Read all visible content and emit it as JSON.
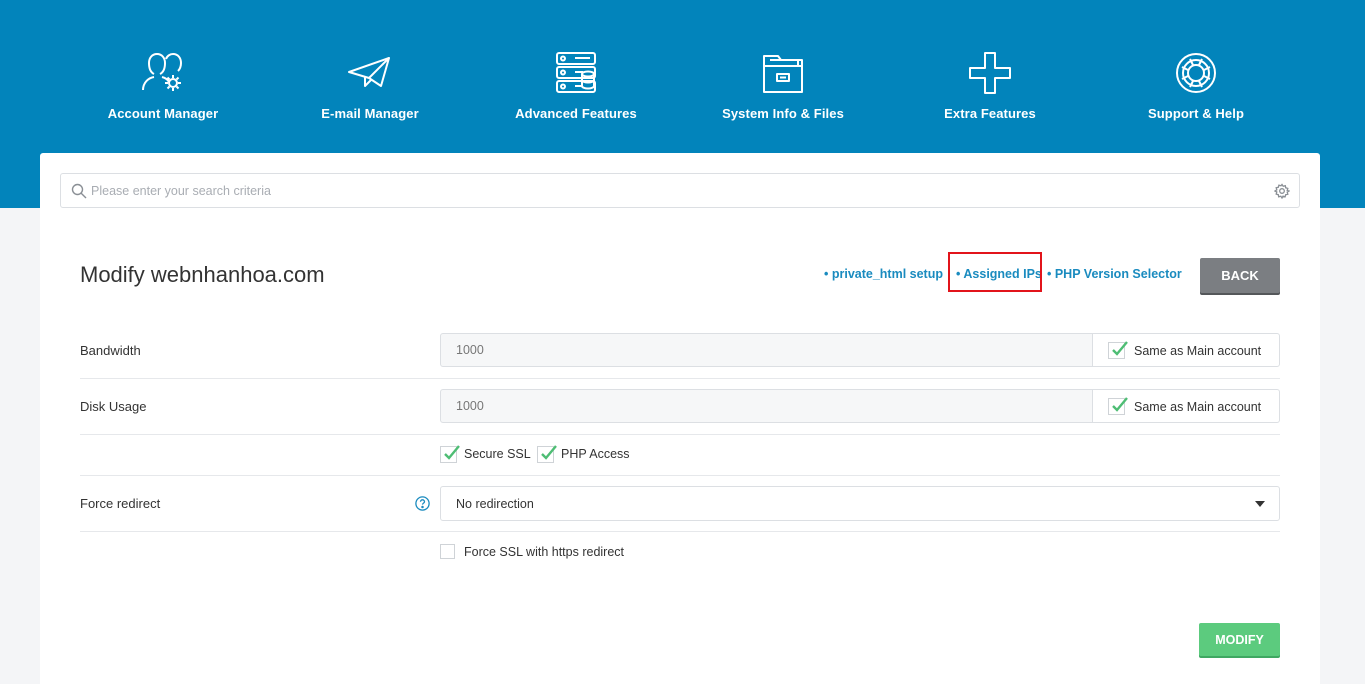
{
  "nav": {
    "items": [
      {
        "label": "Account Manager",
        "icon": "users-gear-icon"
      },
      {
        "label": "E-mail Manager",
        "icon": "paper-plane-icon"
      },
      {
        "label": "Advanced Features",
        "icon": "server-icon"
      },
      {
        "label": "System Info & Files",
        "icon": "folder-icon"
      },
      {
        "label": "Extra Features",
        "icon": "plus-icon"
      },
      {
        "label": "Support & Help",
        "icon": "lifebuoy-icon"
      }
    ]
  },
  "search": {
    "placeholder": "Please enter your search criteria"
  },
  "page": {
    "title": "Modify webnhanhoa.com",
    "links": [
      "• private_html setup",
      "• Assigned IPs",
      "• PHP Version Selector"
    ],
    "back_label": "BACK"
  },
  "form": {
    "bandwidth": {
      "label": "Bandwidth",
      "value": "1000",
      "same_label": "Same as Main account",
      "same_checked": true
    },
    "disk": {
      "label": "Disk Usage",
      "value": "1000",
      "same_label": "Same as Main account",
      "same_checked": true
    },
    "secure_ssl": {
      "label": "Secure SSL",
      "checked": true
    },
    "php_access": {
      "label": "PHP Access",
      "checked": true
    },
    "force_redirect": {
      "label": "Force redirect",
      "selected": "No redirection"
    },
    "force_ssl": {
      "label": "Force SSL with https redirect",
      "checked": false
    },
    "modify_label": "MODIFY"
  },
  "colors": {
    "header_bg": "#0284bb",
    "link": "#1a8bbf",
    "check": "#4ebd74",
    "modify_bg": "#5ccb7e",
    "back_bg": "#7b7e82",
    "highlight": "#e2141b"
  }
}
